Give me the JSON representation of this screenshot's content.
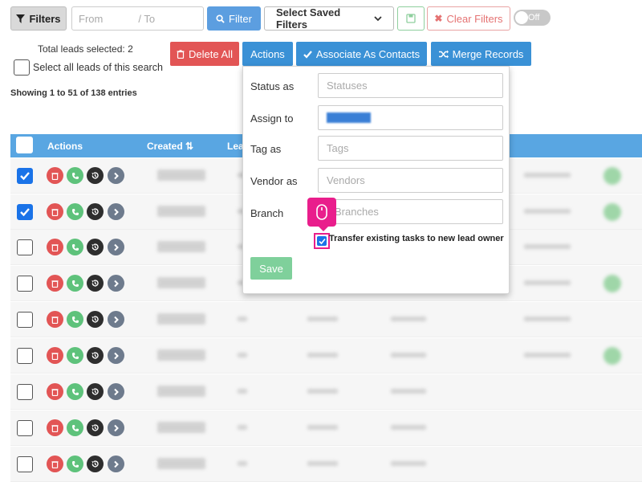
{
  "filters": {
    "filters_label": "Filters",
    "from_placeholder": "From",
    "to_placeholder": "/ To",
    "filter_button": "Filter",
    "saved_filters_label": "Select Saved Filters",
    "clear_filters_label": "Clear Filters",
    "toggle_label": "Off"
  },
  "selection": {
    "total_text": "Total leads selected: 2",
    "select_all_text": "Select all leads of this search",
    "showing_text": "Showing 1 to 51 of 138 entries"
  },
  "bulk_actions": {
    "delete_all": "Delete All",
    "actions": "Actions",
    "associate": "Associate As Contacts",
    "merge": "Merge Records"
  },
  "table": {
    "headers": [
      "Actions",
      "Created",
      "Lea"
    ],
    "row_checked": [
      true,
      true,
      false,
      false,
      false,
      false,
      false,
      false,
      false
    ]
  },
  "panel": {
    "status_label": "Status as",
    "status_placeholder": "Statuses",
    "assign_label": "Assign to",
    "tag_label": "Tag as",
    "tag_placeholder": "Tags",
    "vendor_label": "Vendor as",
    "vendor_placeholder": "Vendors",
    "branch_label": "Branch",
    "branch_placeholder": "Branches",
    "transfer_label": "Transfer existing tasks to new lead owner",
    "transfer_checked": true,
    "save_label": "Save"
  },
  "colors": {
    "primary": "#3a91d6",
    "danger": "#e25555",
    "success": "#5ec27b",
    "highlight": "#e91e8c",
    "table_header": "#59a6e2"
  }
}
